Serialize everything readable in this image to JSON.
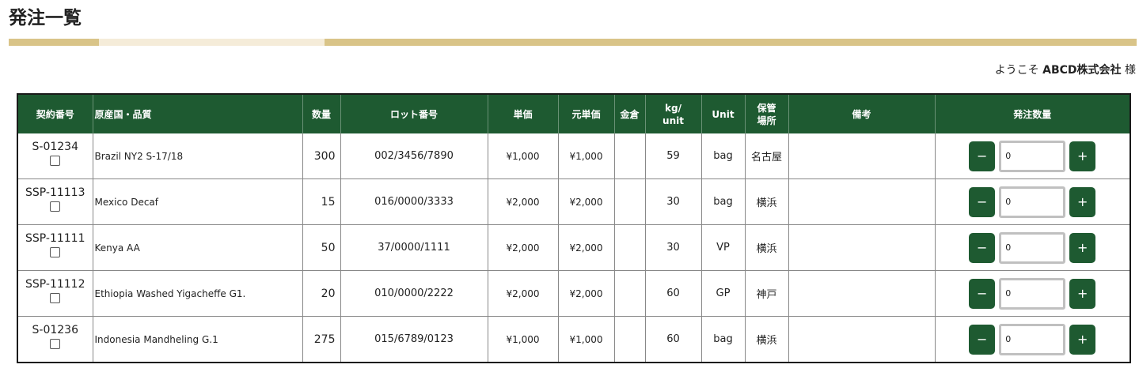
{
  "page": {
    "title": "発注一覧",
    "welcome_prefix": "ようこそ",
    "company": "ABCD株式会社",
    "welcome_suffix": "様"
  },
  "colors": {
    "header_green": "#1e5a31",
    "title_bar_gold": "#d9c488",
    "title_bar_light": "#f5ecd9"
  },
  "table": {
    "headers": {
      "contract": "契約番号",
      "origin": "原産国・品質",
      "quantity": "数量",
      "lot": "ロット番号",
      "unit_price": "単価",
      "base_price": "元単価",
      "warehouse_cost": "金倉",
      "kg_unit_1": "kg/",
      "kg_unit_2": "unit",
      "unit": "Unit",
      "storage_1": "保管",
      "storage_2": "場所",
      "remarks": "備考",
      "order_qty": "発注数量"
    },
    "minus_label": "−",
    "plus_label": "+",
    "rows": [
      {
        "contract": "S-01234",
        "origin": "Brazil NY2 S-17/18",
        "quantity": "300",
        "lot": "002/3456/7890",
        "unit_price": "¥1,000",
        "base_price": "¥1,000",
        "warehouse_cost": "",
        "kg_unit": "59",
        "unit": "bag",
        "storage": "名古屋",
        "remarks": "",
        "order_qty": "0"
      },
      {
        "contract": "SSP-11113",
        "origin": "Mexico Decaf",
        "quantity": "15",
        "lot": "016/0000/3333",
        "unit_price": "¥2,000",
        "base_price": "¥2,000",
        "warehouse_cost": "",
        "kg_unit": "30",
        "unit": "bag",
        "storage": "横浜",
        "remarks": "",
        "order_qty": "0"
      },
      {
        "contract": "SSP-11111",
        "origin": "Kenya AA",
        "quantity": "50",
        "lot": "37/0000/1111",
        "unit_price": "¥2,000",
        "base_price": "¥2,000",
        "warehouse_cost": "",
        "kg_unit": "30",
        "unit": "VP",
        "storage": "横浜",
        "remarks": "",
        "order_qty": "0"
      },
      {
        "contract": "SSP-11112",
        "origin": "Ethiopia Washed Yigacheffe G1.",
        "quantity": "20",
        "lot": "010/0000/2222",
        "unit_price": "¥2,000",
        "base_price": "¥2,000",
        "warehouse_cost": "",
        "kg_unit": "60",
        "unit": "GP",
        "storage": "神戸",
        "remarks": "",
        "order_qty": "0"
      },
      {
        "contract": "S-01236",
        "origin": "Indonesia Mandheling G.1",
        "quantity": "275",
        "lot": "015/6789/0123",
        "unit_price": "¥1,000",
        "base_price": "¥1,000",
        "warehouse_cost": "",
        "kg_unit": "60",
        "unit": "bag",
        "storage": "横浜",
        "remarks": "",
        "order_qty": "0"
      }
    ]
  }
}
